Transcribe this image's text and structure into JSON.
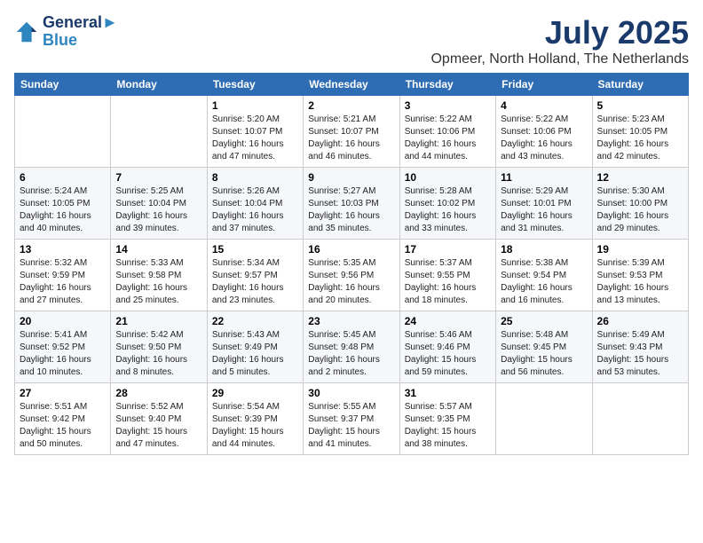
{
  "logo": {
    "line1": "General",
    "line2": "Blue"
  },
  "title": "July 2025",
  "location": "Opmeer, North Holland, The Netherlands",
  "weekdays": [
    "Sunday",
    "Monday",
    "Tuesday",
    "Wednesday",
    "Thursday",
    "Friday",
    "Saturday"
  ],
  "weeks": [
    [
      {
        "day": "",
        "detail": ""
      },
      {
        "day": "",
        "detail": ""
      },
      {
        "day": "1",
        "detail": "Sunrise: 5:20 AM\nSunset: 10:07 PM\nDaylight: 16 hours\nand 47 minutes."
      },
      {
        "day": "2",
        "detail": "Sunrise: 5:21 AM\nSunset: 10:07 PM\nDaylight: 16 hours\nand 46 minutes."
      },
      {
        "day": "3",
        "detail": "Sunrise: 5:22 AM\nSunset: 10:06 PM\nDaylight: 16 hours\nand 44 minutes."
      },
      {
        "day": "4",
        "detail": "Sunrise: 5:22 AM\nSunset: 10:06 PM\nDaylight: 16 hours\nand 43 minutes."
      },
      {
        "day": "5",
        "detail": "Sunrise: 5:23 AM\nSunset: 10:05 PM\nDaylight: 16 hours\nand 42 minutes."
      }
    ],
    [
      {
        "day": "6",
        "detail": "Sunrise: 5:24 AM\nSunset: 10:05 PM\nDaylight: 16 hours\nand 40 minutes."
      },
      {
        "day": "7",
        "detail": "Sunrise: 5:25 AM\nSunset: 10:04 PM\nDaylight: 16 hours\nand 39 minutes."
      },
      {
        "day": "8",
        "detail": "Sunrise: 5:26 AM\nSunset: 10:04 PM\nDaylight: 16 hours\nand 37 minutes."
      },
      {
        "day": "9",
        "detail": "Sunrise: 5:27 AM\nSunset: 10:03 PM\nDaylight: 16 hours\nand 35 minutes."
      },
      {
        "day": "10",
        "detail": "Sunrise: 5:28 AM\nSunset: 10:02 PM\nDaylight: 16 hours\nand 33 minutes."
      },
      {
        "day": "11",
        "detail": "Sunrise: 5:29 AM\nSunset: 10:01 PM\nDaylight: 16 hours\nand 31 minutes."
      },
      {
        "day": "12",
        "detail": "Sunrise: 5:30 AM\nSunset: 10:00 PM\nDaylight: 16 hours\nand 29 minutes."
      }
    ],
    [
      {
        "day": "13",
        "detail": "Sunrise: 5:32 AM\nSunset: 9:59 PM\nDaylight: 16 hours\nand 27 minutes."
      },
      {
        "day": "14",
        "detail": "Sunrise: 5:33 AM\nSunset: 9:58 PM\nDaylight: 16 hours\nand 25 minutes."
      },
      {
        "day": "15",
        "detail": "Sunrise: 5:34 AM\nSunset: 9:57 PM\nDaylight: 16 hours\nand 23 minutes."
      },
      {
        "day": "16",
        "detail": "Sunrise: 5:35 AM\nSunset: 9:56 PM\nDaylight: 16 hours\nand 20 minutes."
      },
      {
        "day": "17",
        "detail": "Sunrise: 5:37 AM\nSunset: 9:55 PM\nDaylight: 16 hours\nand 18 minutes."
      },
      {
        "day": "18",
        "detail": "Sunrise: 5:38 AM\nSunset: 9:54 PM\nDaylight: 16 hours\nand 16 minutes."
      },
      {
        "day": "19",
        "detail": "Sunrise: 5:39 AM\nSunset: 9:53 PM\nDaylight: 16 hours\nand 13 minutes."
      }
    ],
    [
      {
        "day": "20",
        "detail": "Sunrise: 5:41 AM\nSunset: 9:52 PM\nDaylight: 16 hours\nand 10 minutes."
      },
      {
        "day": "21",
        "detail": "Sunrise: 5:42 AM\nSunset: 9:50 PM\nDaylight: 16 hours\nand 8 minutes."
      },
      {
        "day": "22",
        "detail": "Sunrise: 5:43 AM\nSunset: 9:49 PM\nDaylight: 16 hours\nand 5 minutes."
      },
      {
        "day": "23",
        "detail": "Sunrise: 5:45 AM\nSunset: 9:48 PM\nDaylight: 16 hours\nand 2 minutes."
      },
      {
        "day": "24",
        "detail": "Sunrise: 5:46 AM\nSunset: 9:46 PM\nDaylight: 15 hours\nand 59 minutes."
      },
      {
        "day": "25",
        "detail": "Sunrise: 5:48 AM\nSunset: 9:45 PM\nDaylight: 15 hours\nand 56 minutes."
      },
      {
        "day": "26",
        "detail": "Sunrise: 5:49 AM\nSunset: 9:43 PM\nDaylight: 15 hours\nand 53 minutes."
      }
    ],
    [
      {
        "day": "27",
        "detail": "Sunrise: 5:51 AM\nSunset: 9:42 PM\nDaylight: 15 hours\nand 50 minutes."
      },
      {
        "day": "28",
        "detail": "Sunrise: 5:52 AM\nSunset: 9:40 PM\nDaylight: 15 hours\nand 47 minutes."
      },
      {
        "day": "29",
        "detail": "Sunrise: 5:54 AM\nSunset: 9:39 PM\nDaylight: 15 hours\nand 44 minutes."
      },
      {
        "day": "30",
        "detail": "Sunrise: 5:55 AM\nSunset: 9:37 PM\nDaylight: 15 hours\nand 41 minutes."
      },
      {
        "day": "31",
        "detail": "Sunrise: 5:57 AM\nSunset: 9:35 PM\nDaylight: 15 hours\nand 38 minutes."
      },
      {
        "day": "",
        "detail": ""
      },
      {
        "day": "",
        "detail": ""
      }
    ]
  ]
}
